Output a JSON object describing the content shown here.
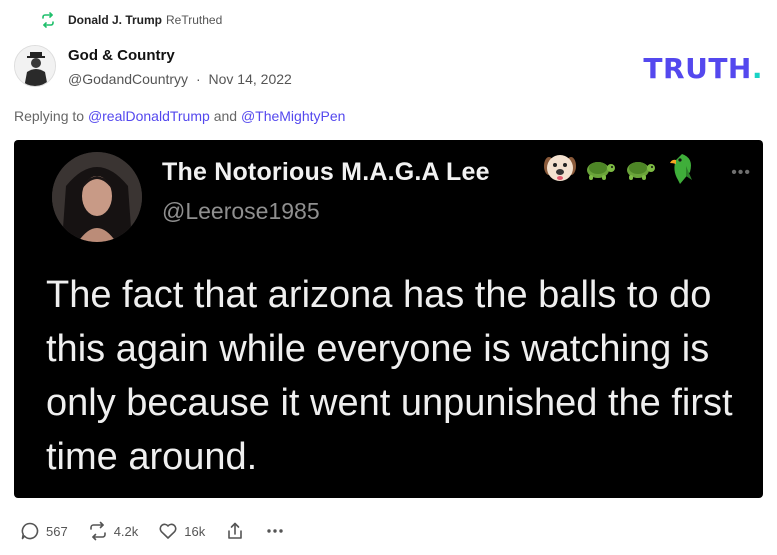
{
  "retruth": {
    "user_name": "Donald J. Trump",
    "label": "ReTruthed"
  },
  "author": {
    "display_name": "God & Country",
    "handle": "@GodandCountryy",
    "separator": "·",
    "date": "Nov 14, 2022"
  },
  "brand": {
    "text": "TRUTH",
    "dot": "."
  },
  "reply": {
    "prefix": "Replying to",
    "mention1": "@realDonaldTrump",
    "conjunction": "and",
    "mention2": "@TheMightyPen"
  },
  "embedded_tweet": {
    "name": "The Notorious M.A.G.A Lee",
    "handle": "@Leerose1985",
    "more": "•••",
    "emojis": [
      "dog-face-icon",
      "turtle-icon",
      "turtle-icon",
      "parrot-icon"
    ],
    "text": "The fact that arizona has the balls to do this again while everyone is watching is only because it went unpunished the first time around."
  },
  "actions": {
    "replies": "567",
    "retruths": "4.2k",
    "likes": "16k"
  },
  "colors": {
    "accent": "#5448ee",
    "retruth_green": "#1fbf6b",
    "brand_dot": "#19d3c5"
  }
}
